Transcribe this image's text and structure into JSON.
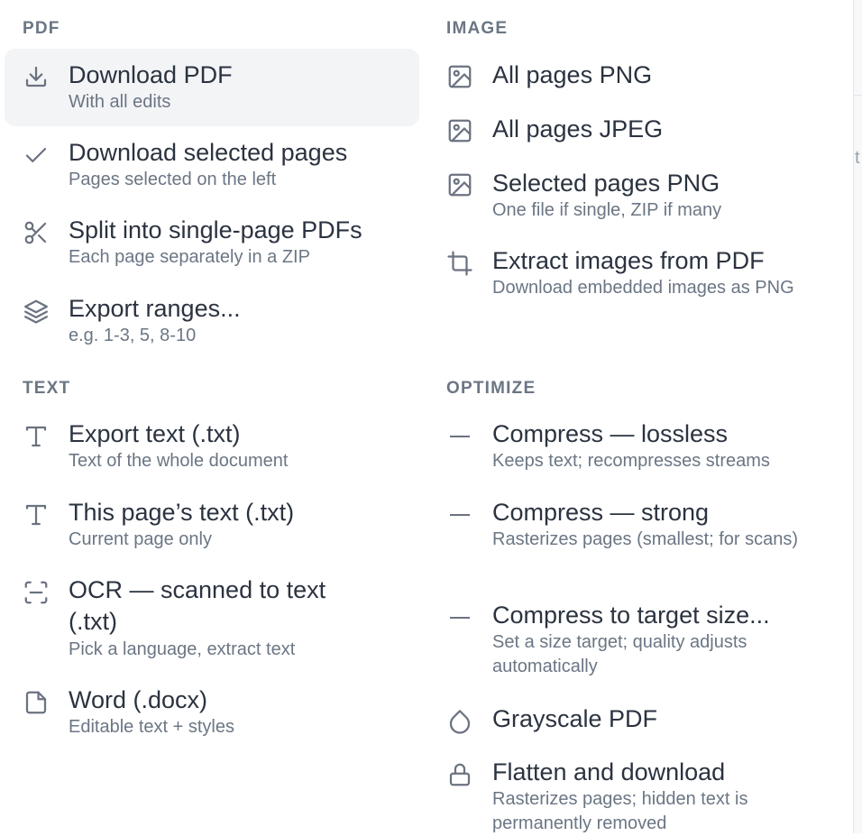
{
  "sections": {
    "pdf": "PDF",
    "image": "IMAGE",
    "text": "TEXT",
    "optimize": "OPTIMIZE"
  },
  "pdf_items": [
    {
      "icon": "download-icon",
      "label": "Download PDF",
      "sub": "With all edits"
    },
    {
      "icon": "check-icon",
      "label": "Download selected pages",
      "sub": "Pages selected on the left"
    },
    {
      "icon": "scissors-icon",
      "label": "Split into single-page PDFs",
      "sub": "Each page separately in a ZIP"
    },
    {
      "icon": "layers-icon",
      "label": "Export ranges...",
      "sub": "e.g. 1-3, 5, 8-10"
    }
  ],
  "text_items": [
    {
      "icon": "text-icon",
      "label": "Export text (.txt)",
      "sub": "Text of the whole document"
    },
    {
      "icon": "text-icon",
      "label": "This page’s text (.txt)",
      "sub": "Current page only"
    },
    {
      "icon": "scan-text-icon",
      "label": "OCR — scanned to text (.txt)",
      "sub": "Pick a language, extract text"
    },
    {
      "icon": "file-icon",
      "label": "Word (.docx)",
      "sub": "Editable text + styles"
    }
  ],
  "image_items": [
    {
      "icon": "image-icon",
      "label": "All pages PNG",
      "sub": ""
    },
    {
      "icon": "image-icon",
      "label": "All pages JPEG",
      "sub": ""
    },
    {
      "icon": "image-icon",
      "label": "Selected pages PNG",
      "sub": "One file if single, ZIP if many"
    },
    {
      "icon": "crop-icon",
      "label": "Extract images from PDF",
      "sub": "Download embedded images as PNG"
    }
  ],
  "optimize_items": [
    {
      "icon": "minus-icon",
      "label": "Compress — lossless",
      "sub": "Keeps text; recompresses streams"
    },
    {
      "icon": "minus-icon",
      "label": "Compress — strong",
      "sub": "Rasterizes pages (smallest; for scans)"
    },
    {
      "icon": "minus-icon",
      "label": "Compress to target size...",
      "sub": "Set a size target; quality adjusts automatically"
    },
    {
      "icon": "droplet-icon",
      "label": "Grayscale PDF",
      "sub": ""
    },
    {
      "icon": "lock-icon",
      "label": "Flatten and download",
      "sub": "Rasterizes pages; hidden text is permanently removed"
    }
  ],
  "edge_text": "t"
}
